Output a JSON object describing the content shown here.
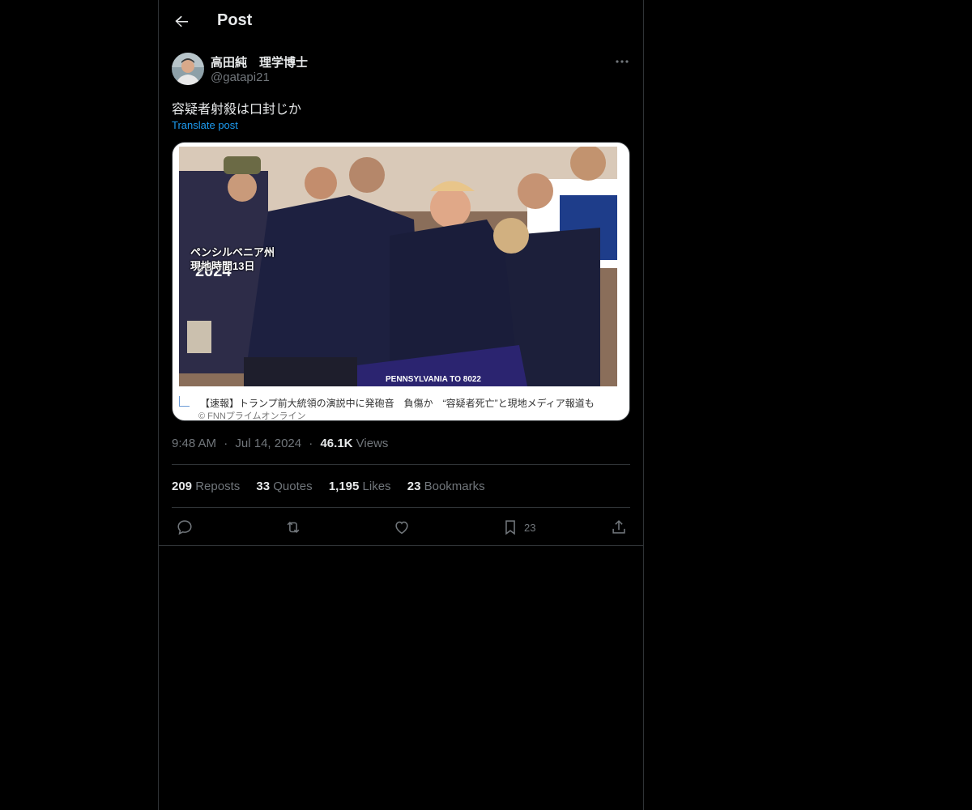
{
  "header": {
    "title": "Post"
  },
  "author": {
    "name": "高田純　理学博士",
    "handle": "@gatapi21"
  },
  "post": {
    "text": "容疑者射殺は口封じか",
    "translate_label": "Translate post",
    "media": {
      "overlay_line1": "ペンシルベニア州",
      "overlay_line2": "現地時間13日",
      "caption": "【速報】トランプ前大統領の演説中に発砲音　負傷か　“容疑者死亡”と現地メディア報道も",
      "credit": "© FNNプライムオンライン"
    },
    "time": "9:48 AM",
    "date": "Jul 14, 2024",
    "views_count": "46.1K",
    "views_label": "Views",
    "separator": "·"
  },
  "stats": [
    {
      "count": "209",
      "label": "Reposts"
    },
    {
      "count": "33",
      "label": "Quotes"
    },
    {
      "count": "1,195",
      "label": "Likes"
    },
    {
      "count": "23",
      "label": "Bookmarks"
    }
  ],
  "actions": {
    "reply": {
      "icon": "reply-icon"
    },
    "repost": {
      "icon": "repost-icon"
    },
    "like": {
      "icon": "heart-icon"
    },
    "bookmark": {
      "icon": "bookmark-icon",
      "count": "23"
    },
    "share": {
      "icon": "share-icon"
    }
  },
  "colors": {
    "accent": "#1d9bf0",
    "muted": "#71767b",
    "text": "#e7e9ea",
    "border": "#2f3336",
    "background": "#000000"
  }
}
